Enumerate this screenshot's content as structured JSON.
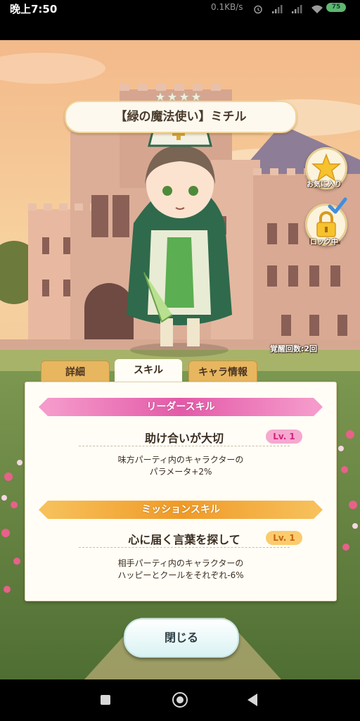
{
  "status_bar": {
    "time": "晚上7:50",
    "network": "0.1KB/s",
    "battery": "75",
    "icons": [
      "alarm-icon",
      "signal-icon",
      "signal-icon",
      "wifi-icon",
      "battery-icon"
    ]
  },
  "character": {
    "name": "【緑の魔法使い】ミチル",
    "rarity_stars": 4
  },
  "side_buttons": {
    "favorite_label": "お気に入り",
    "lock_label": "ロック中"
  },
  "awaken_count": "覚醒回数:2回",
  "tabs": [
    {
      "label": "詳細",
      "active": false
    },
    {
      "label": "スキル",
      "active": true
    },
    {
      "label": "キャラ情報",
      "active": false
    }
  ],
  "leader_skill": {
    "header": "リーダースキル",
    "name": "助け合いが大切",
    "level": "Lv. 1",
    "desc_line1": "味方パーティ内のキャラクターの",
    "desc_line2": "パラメータ+2%"
  },
  "mission_skill": {
    "header": "ミッションスキル",
    "name": "心に届く言葉を探して",
    "level": "Lv. 1",
    "desc_line1": "相手パーティ内のキャラクターの",
    "desc_line2": "ハッピーとクールをそれぞれ-6%"
  },
  "close_label": "閉じる",
  "colors": {
    "leader": "#e35aa8",
    "mission": "#f09a27",
    "tab_inactive": "#e7b65f",
    "panel": "#fffdf6"
  }
}
